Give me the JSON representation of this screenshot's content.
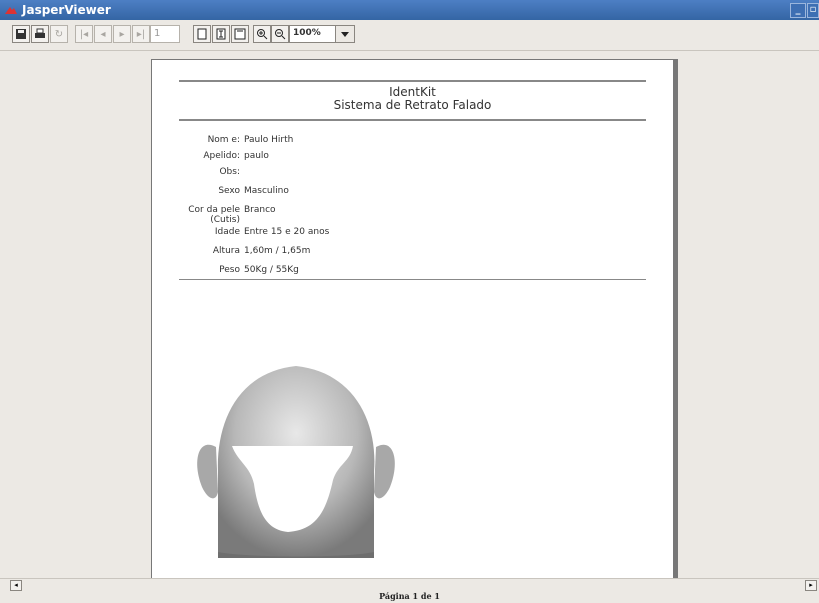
{
  "window": {
    "title": "JasperViewer"
  },
  "toolbar": {
    "page_field_value": "1",
    "zoom_value": "100%"
  },
  "report": {
    "title": "IdentKit",
    "subtitle": "Sistema de Retrato Falado",
    "fields": [
      {
        "label": "Nom e:",
        "value": "Paulo Hirth"
      },
      {
        "label": "Apelido:",
        "value": "paulo"
      },
      {
        "label": "Obs:",
        "value": ""
      },
      {
        "label": "Sexo",
        "value": "Masculino"
      },
      {
        "label_line1": "Cor da pele",
        "label_line2": "(Cutis)",
        "value": "Branco"
      },
      {
        "label": "Idade",
        "value": "Entre 15 e 20 anos"
      },
      {
        "label": "Altura",
        "value": "1,60m / 1,65m"
      },
      {
        "label": "Peso",
        "value": "50Kg / 55Kg"
      }
    ]
  },
  "status": {
    "page_info": "Página 1 de 1"
  },
  "colors": {
    "titlebar": "#3465a4",
    "background": "#ece9e4",
    "paper": "#ffffff"
  }
}
